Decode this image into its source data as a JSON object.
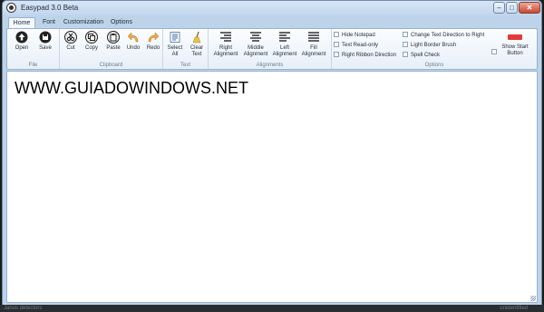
{
  "window": {
    "title": "Easypad 3.0 Beta",
    "minimize_glyph": "–",
    "maximize_glyph": "□",
    "close_glyph": "✕"
  },
  "tabs": [
    "Home",
    "Font",
    "Customization",
    "Options"
  ],
  "ribbon": {
    "file": {
      "label": "File",
      "buttons": [
        "Open",
        "Save"
      ]
    },
    "clipboard": {
      "label": "Clipboard",
      "buttons": [
        "Cut",
        "Copy",
        "Paste",
        "Undo",
        "Redo"
      ]
    },
    "text": {
      "label": "Text",
      "buttons": [
        "Select\nAll",
        "Clear\nText"
      ]
    },
    "alignments": {
      "label": "Alignments",
      "buttons": [
        "Right\nAlignment",
        "Middle\nAlignment",
        "Left\nAlignment",
        "Fill\nAlignment"
      ]
    },
    "options": {
      "label": "Options",
      "checkboxes": [
        "Hide Notepad",
        "Text Read-only",
        "Right Ribbon Direction",
        "Change Text Direction to Right",
        "Light Border Brush",
        "Spell Check"
      ],
      "show_start_button": "Show Start\nButton"
    }
  },
  "editor": {
    "text": "WWW.GUIADOWINDOWS.NET"
  },
  "desktop": {
    "left_text": "Janus detectors",
    "right_text": "unidentified"
  },
  "colors": {
    "accent": "#e23a35",
    "ribbon_bg": "#f4f8fd",
    "frame": "#bcd3ea"
  }
}
